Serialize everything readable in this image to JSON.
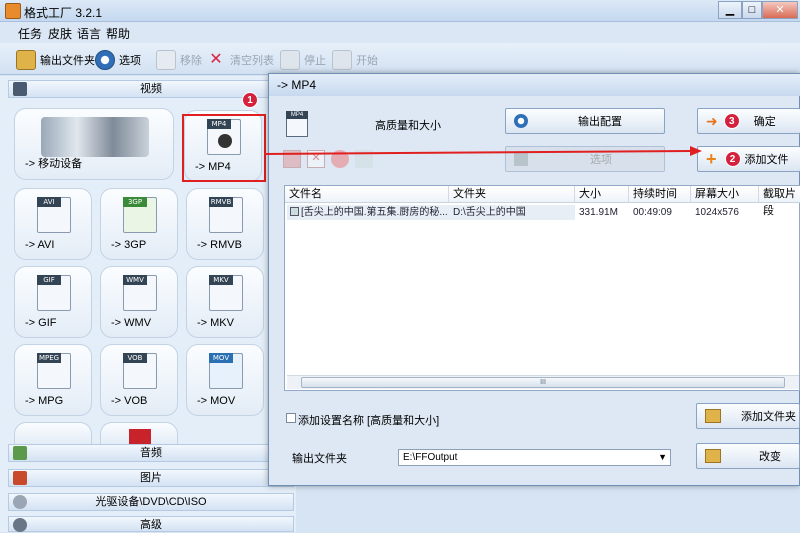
{
  "app": {
    "title": "格式工厂 3.2.1"
  },
  "menu": [
    "任务",
    "皮肤",
    "语言",
    "帮助"
  ],
  "toolbar": {
    "output_folder": "输出文件夹",
    "options": "选项",
    "remove": "移除",
    "clear_list": "清空列表",
    "stop": "停止",
    "start": "开始"
  },
  "categories": {
    "video": "视频",
    "audio": "音频",
    "picture": "图片",
    "rom": "光驱设备\\DVD\\CD\\ISO",
    "advanced": "高级"
  },
  "tiles": [
    {
      "label": "-> 移动设备",
      "tag": ""
    },
    {
      "label": "-> MP4",
      "tag": "MP4"
    },
    {
      "label": "-> AVI",
      "tag": "AVI"
    },
    {
      "label": "-> 3GP",
      "tag": "3GP"
    },
    {
      "label": "-> RMVB",
      "tag": "RMVB"
    },
    {
      "label": "-> GIF",
      "tag": "GIF"
    },
    {
      "label": "-> WMV",
      "tag": "WMV"
    },
    {
      "label": "-> MKV",
      "tag": "MKV"
    },
    {
      "label": "-> MPG",
      "tag": "MPEG"
    },
    {
      "label": "-> VOB",
      "tag": "VOB"
    },
    {
      "label": "-> MOV",
      "tag": "MOV"
    }
  ],
  "dialog": {
    "title": "-> MP4",
    "profile": "高质量和大小",
    "output_config": "输出配置",
    "ok": "确定",
    "options": "选项",
    "add_file": "添加文件",
    "columns": [
      "文件名",
      "文件夹",
      "大小",
      "持续时间",
      "屏幕大小",
      "截取片段"
    ],
    "rows": [
      {
        "name": "[舌尖上的中国.第五集.厨房的秘...",
        "folder": "D:\\舌尖上的中国",
        "size": "331.91M",
        "duration": "00:49:09",
        "screen": "1024x576"
      }
    ],
    "scroll_grip": "III",
    "add_setting_name": "添加设置名称 [高质量和大小]",
    "add_folder": "添加文件夹",
    "output_folder_label": "输出文件夹",
    "output_path": "E:\\FFOutput",
    "change": "改变"
  },
  "annotations": [
    "1",
    "2",
    "3"
  ],
  "colors": {
    "annotation": "#d4213d",
    "highlight": "#e02020"
  }
}
